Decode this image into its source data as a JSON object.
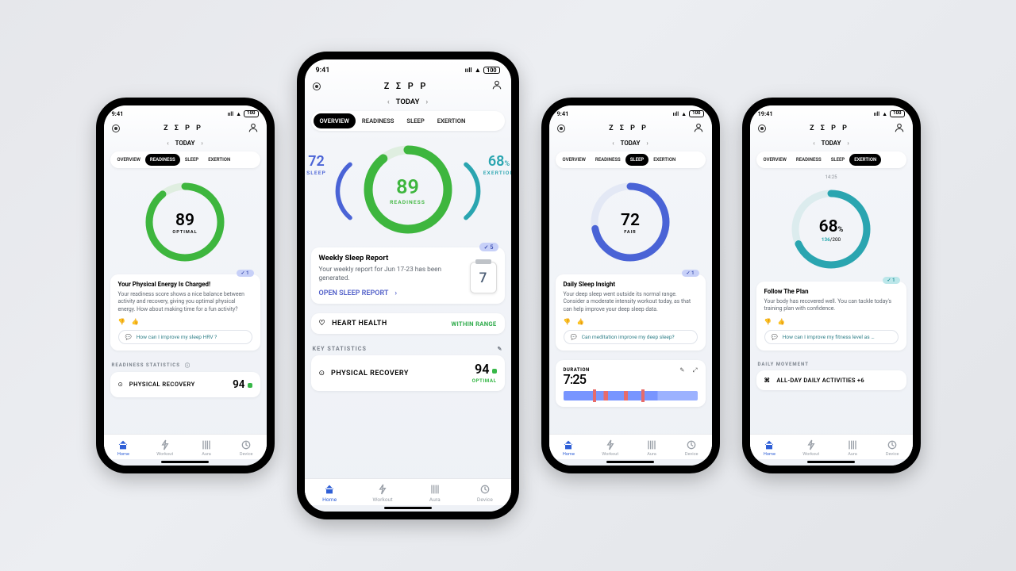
{
  "common": {
    "brand": "Z Σ P P",
    "date_label": "TODAY",
    "battery": "100",
    "tabs": {
      "overview": "OVERVIEW",
      "readiness": "READINESS",
      "sleep": "SLEEP",
      "exertion": "EXERTION"
    },
    "navbar": {
      "home": "Home",
      "workout": "Workout",
      "aura": "Aura",
      "device": "Device"
    }
  },
  "readiness": {
    "time": "9:41",
    "score": "89",
    "score_label": "OPTIMAL",
    "ring_color": "#3eb63e",
    "card": {
      "badge": "✓  1",
      "title": "Your Physical Energy Is Charged!",
      "body": "Your readiness score shows a nice balance between activity and recovery, giving you optimal physical energy. How about making time for a fun activity?",
      "suggestion": "How can I improve my sleep HRV ?"
    },
    "section": "READINESS STATISTICS",
    "stat": {
      "label": "PHYSICAL RECOVERY",
      "value": "94"
    }
  },
  "overview": {
    "time": "9:41",
    "sleep": {
      "value": "72",
      "label": "SLEEP",
      "color": "#4a63d6"
    },
    "readiness": {
      "value": "89",
      "label": "READINESS",
      "color": "#3eb63e"
    },
    "exertion": {
      "value": "68",
      "unit": "%",
      "label": "EXERTION",
      "color": "#2aa5b0"
    },
    "report": {
      "badge": "✓  5",
      "title": "Weekly Sleep Report",
      "body": "Your weekly report for Jun 17-23 has been generated.",
      "link": "OPEN SLEEP REPORT",
      "calendar_day": "7"
    },
    "heart": {
      "label": "HEART HEALTH",
      "status": "WITHIN RANGE"
    },
    "key_section": "KEY STATISTICS",
    "stat": {
      "label": "PHYSICAL RECOVERY",
      "value": "94",
      "status": "OPTIMAL"
    }
  },
  "sleep": {
    "time": "9:41",
    "score": "72",
    "score_label": "FAIR",
    "ring_color": "#4a63d6",
    "card": {
      "badge": "✓  1",
      "title": "Daily Sleep Insight",
      "body": "Your deep sleep went outside its normal range. Consider a moderate intensity workout today, as that can help improve your deep sleep data.",
      "suggestion": "Can meditation improve my deep sleep?"
    },
    "duration": {
      "label": "DURATION",
      "value": "7:25"
    }
  },
  "exertion": {
    "time": "19:41",
    "timestamp": "14:25",
    "score": "68",
    "score_unit": "%",
    "fraction": {
      "current": "136",
      "total": "/200"
    },
    "ring_color": "#2aa5b0",
    "card": {
      "badge": "✓  1",
      "title": "Follow The Plan",
      "body": "Your body has recovered well. You can tackle today's training plan with confidence.",
      "suggestion": "How can I improve my fitness level as …"
    },
    "section": "DAILY MOVEMENT",
    "row": "ALL-DAY DAILY ACTIVITIES +6"
  }
}
